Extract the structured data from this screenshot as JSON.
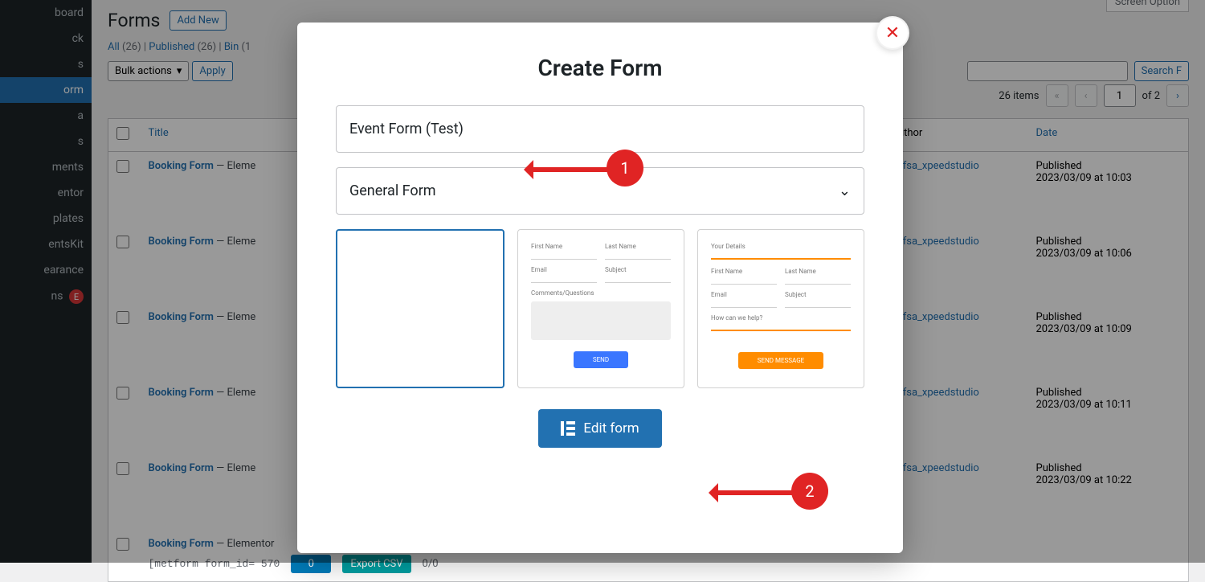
{
  "sidebar": {
    "items": [
      {
        "label": "board"
      },
      {
        "label": "ck"
      },
      {
        "label": "s"
      },
      {
        "label": "orm",
        "active": true
      },
      {
        "label": "a"
      },
      {
        "label": "s"
      },
      {
        "label": "ments"
      },
      {
        "label": "entor"
      },
      {
        "label": "plates"
      },
      {
        "label": "entsKit"
      },
      {
        "label": "earance"
      },
      {
        "label": "ns",
        "badge": "E"
      }
    ]
  },
  "header": {
    "title": "Forms",
    "add_new": "Add New",
    "screen_options": "Screen Option"
  },
  "subsub": {
    "all_label": "All",
    "all_count": "(26)",
    "published_label": "Published",
    "published_count": "(26)",
    "bin_label": "Bin",
    "bin_count": "(1"
  },
  "bulk": {
    "label": "Bulk actions",
    "apply": "Apply"
  },
  "search": {
    "placeholder": "",
    "button": "Search F"
  },
  "pager": {
    "items_text": "26 items",
    "current": "1",
    "of_text": "of 2"
  },
  "table": {
    "cols": {
      "title": "Title",
      "author": "Author",
      "date": "Date"
    },
    "date_status": "Published",
    "rows": [
      {
        "title": "Booking Form",
        "suffix": "— Eleme",
        "author": "hafsa_xpeedstudio",
        "date": "2023/03/09 at 10:03"
      },
      {
        "title": "Booking Form",
        "suffix": "— Eleme",
        "author": "hafsa_xpeedstudio",
        "date": "2023/03/09 at 10:06"
      },
      {
        "title": "Booking Form",
        "suffix": "— Eleme",
        "author": "hafsa_xpeedstudio",
        "date": "2023/03/09 at 10:09"
      },
      {
        "title": "Booking Form",
        "suffix": "— Eleme",
        "author": "hafsa_xpeedstudio",
        "date": "2023/03/09 at 10:11"
      },
      {
        "title": "Booking Form",
        "suffix": "— Eleme",
        "author": "hafsa_xpeedstudio",
        "date": "2023/03/09 at 10:22"
      },
      {
        "title": "Booking Form",
        "suffix": "— Elementor",
        "author": "",
        "date": ""
      }
    ],
    "shortcode": "[metform form_id= 570",
    "entries_count": "0",
    "csv_label": "Export CSV",
    "views_label": "0/0"
  },
  "modal": {
    "title": "Create Form",
    "name_value": "Event Form (Test)",
    "type_value": "General Form",
    "templates": {
      "t2": {
        "fn": "First Name",
        "ln": "Last Name",
        "em": "Email",
        "sub": "Subject",
        "cq": "Comments/Questions",
        "btn": "SEND"
      },
      "t3": {
        "yd": "Your Details",
        "fn": "First Name",
        "ln": "Last Name",
        "em": "Email",
        "sub": "Subject",
        "hc": "How can we help?",
        "btn": "SEND MESSAGE"
      }
    },
    "footer_btn": "Edit form"
  },
  "annotations": {
    "one": "1",
    "two": "2"
  }
}
